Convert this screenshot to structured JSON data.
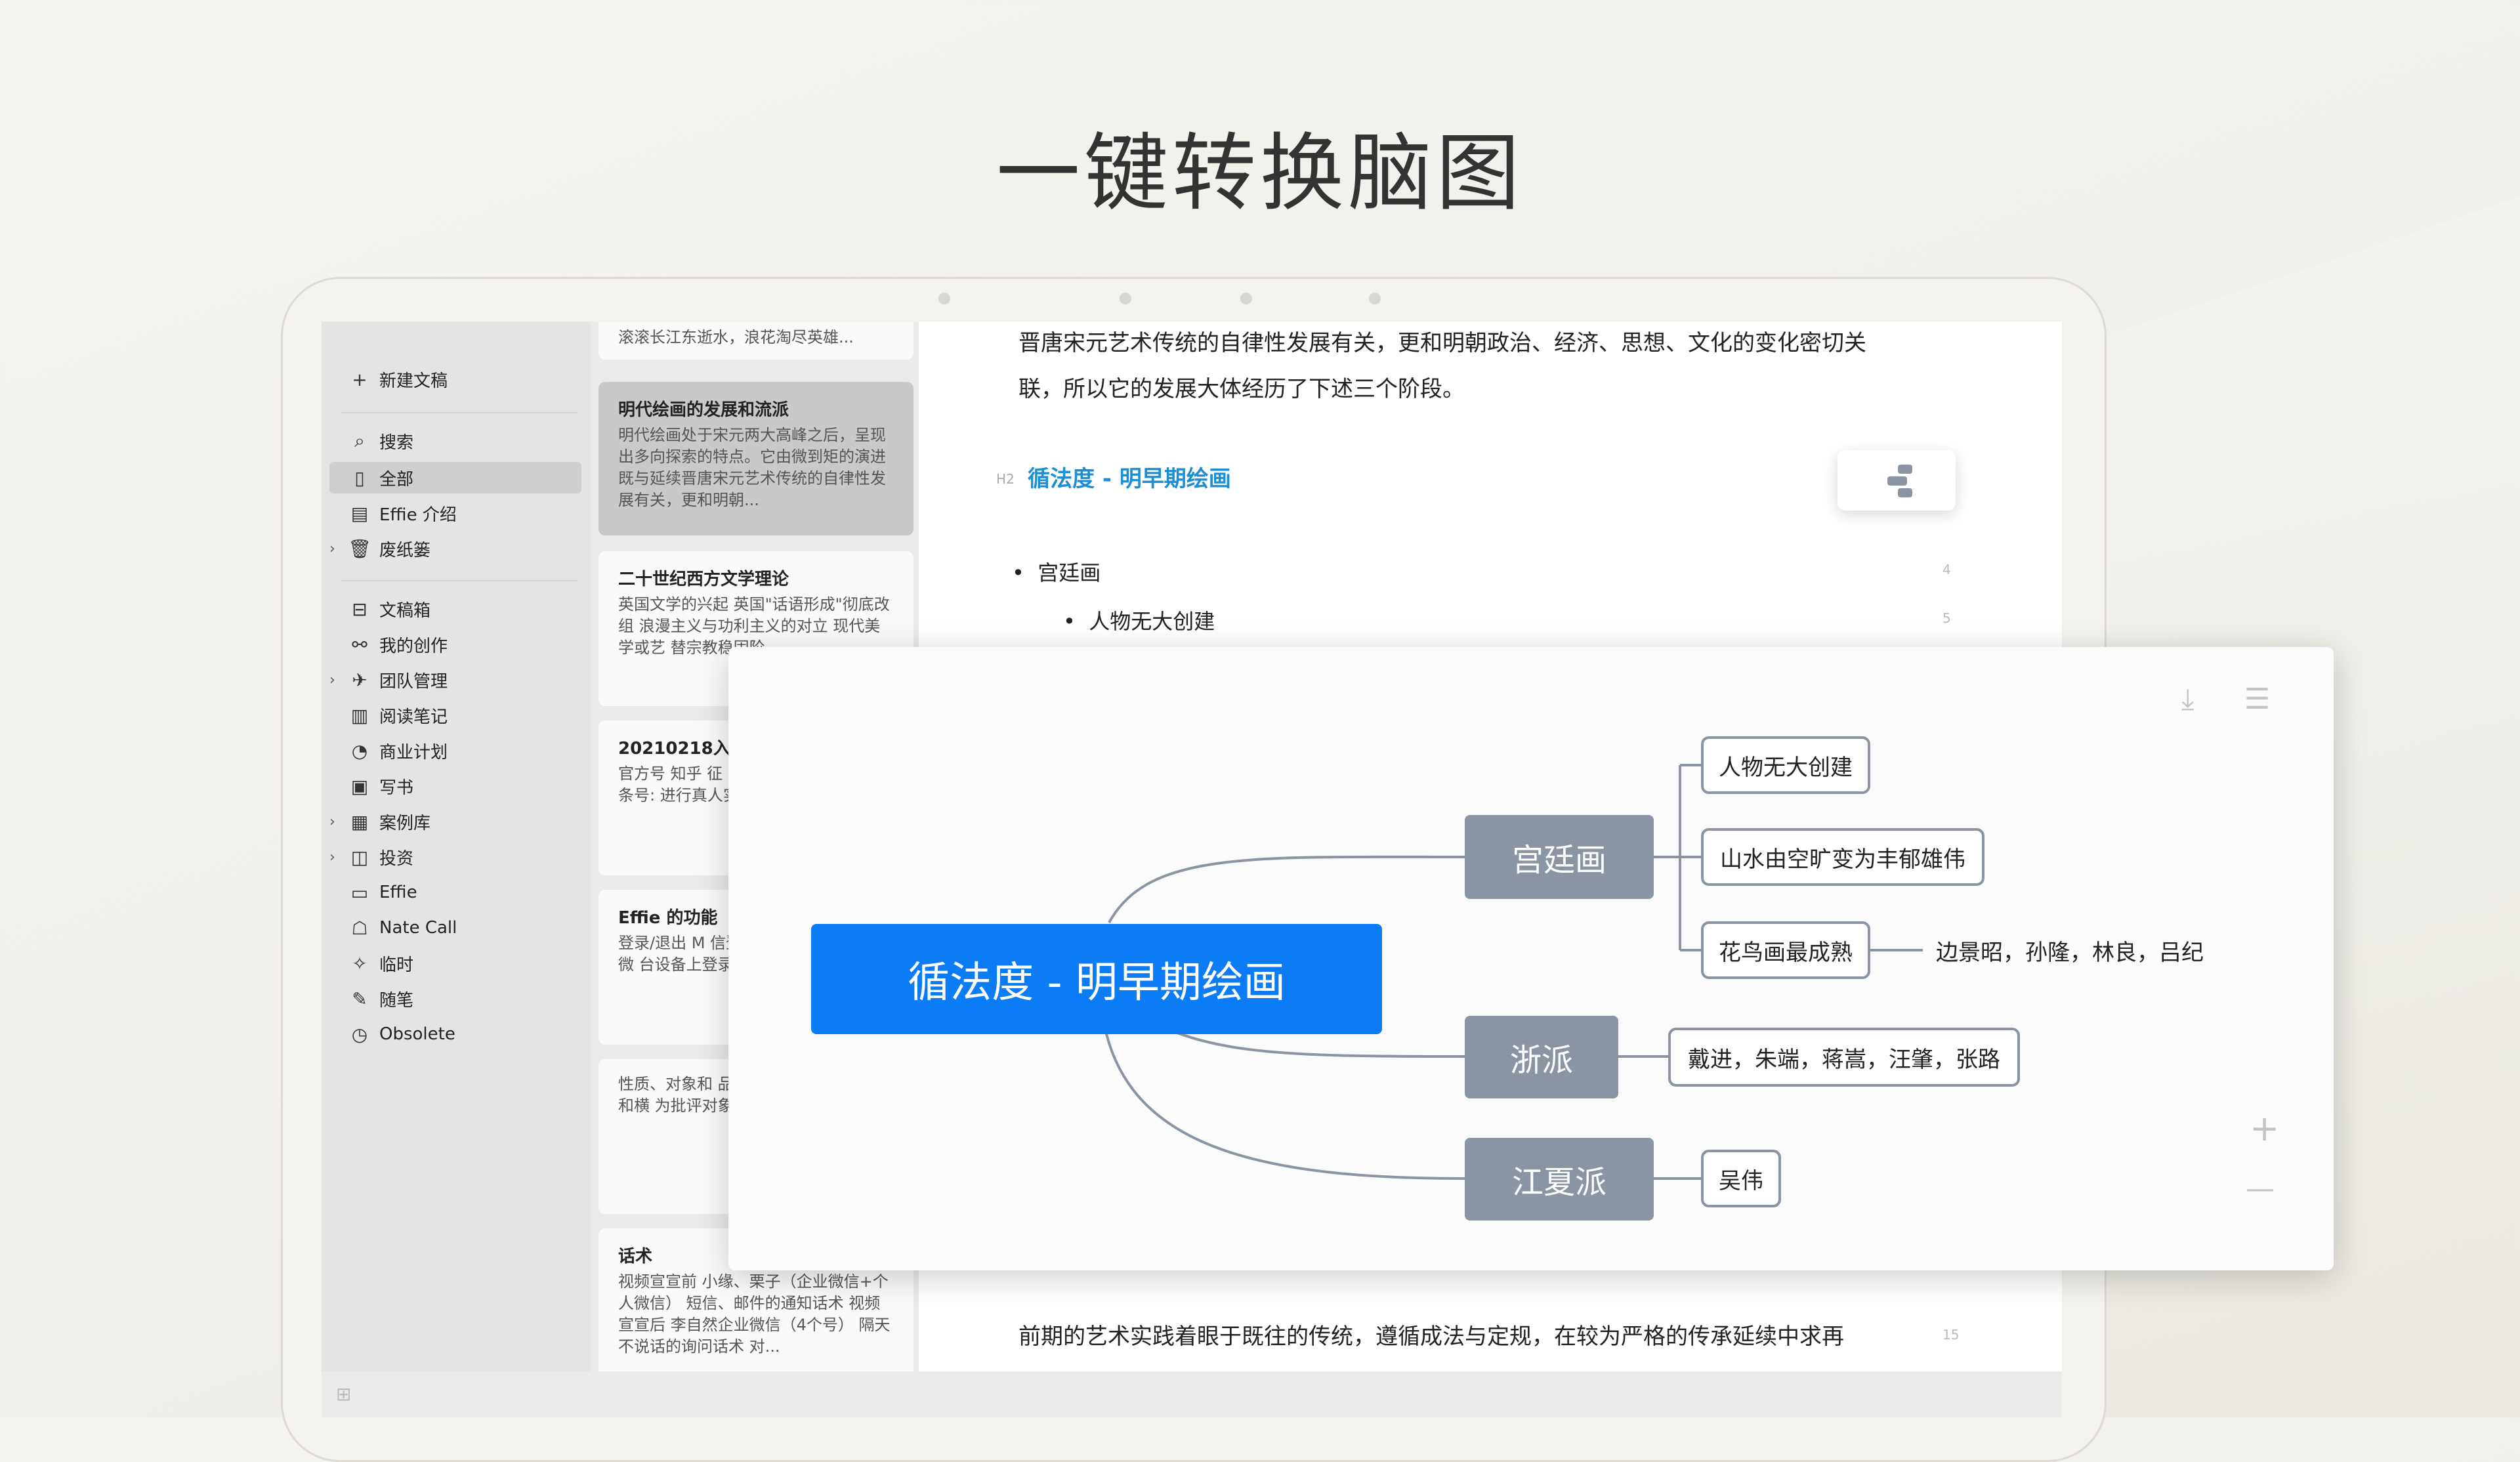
{
  "headline": "一键转换脑图",
  "sidebar": {
    "new_doc": "新建文稿",
    "items": [
      {
        "label": "搜索",
        "icon": "⌕"
      },
      {
        "label": "全部",
        "icon": "▯"
      },
      {
        "label": "Effie 介绍",
        "icon": "▤"
      },
      {
        "label": "废纸篓",
        "icon": "🗑"
      },
      {
        "label": "文稿箱",
        "icon": "⊟"
      },
      {
        "label": "我的创作",
        "icon": "⚯"
      },
      {
        "label": "团队管理",
        "icon": "✈"
      },
      {
        "label": "阅读笔记",
        "icon": "▥"
      },
      {
        "label": "商业计划",
        "icon": "◔"
      },
      {
        "label": "写书",
        "icon": "▣"
      },
      {
        "label": "案例库",
        "icon": "▦"
      },
      {
        "label": "投资",
        "icon": "◫"
      },
      {
        "label": "Effie",
        "icon": "▭"
      },
      {
        "label": "Nate Call",
        "icon": "☖"
      },
      {
        "label": "临时",
        "icon": "✧"
      },
      {
        "label": "随笔",
        "icon": "✎"
      },
      {
        "label": "Obsolete",
        "icon": "◷"
      }
    ]
  },
  "doclist": {
    "cards": [
      {
        "title": "",
        "body": "滚滚长江东逝水，浪花淘尽英雄..."
      },
      {
        "title": "明代绘画的发展和流派",
        "body": "明代绘画处于宋元两大高峰之后，呈现出多向探索的特点。它由微到矩的演进既与延续晋唐宋元艺术传统的自律性发展有关，更和明朝..."
      },
      {
        "title": "二十世纪西方文学理论",
        "body": "英国文学的兴起 英国\"话语形成\"彻底改组 浪漫主义与功利主义的对立 现代美学或艺 替宗教稳固阶"
      },
      {
        "title": "20210218入",
        "body": "官方号 知乎 征 百度 界面 一人 鹏号 头条号: 进行真人实名"
      },
      {
        "title": "Effie 的功能",
        "body": "登录/退出 M 信登录 | App 目前只支持微 台设备上登录"
      },
      {
        "title": "",
        "body": "性质、对象和 品格的确立人 能、理论和横 为批评对象 科 发展过程 预测"
      },
      {
        "title": "话术",
        "body": "视频宣宣前 小缘、栗子（企业微信+个人微信） 短信、邮件的通知话术 视频宣宣后 李自然企业微信（4个号） 隔天不说话的询问话术 对..."
      }
    ]
  },
  "editor": {
    "para_top": [
      "晋唐宋元艺术传统的自律性发展有关，更和明朝政治、经济、思想、文化的变化密切关",
      "联，所以它的发展大体经历了下述三个阶段。"
    ],
    "h2_tag": "H2",
    "h2_title": "循法度 - 明早期绘画",
    "bullet1": "宫廷画",
    "bullet1_num": "4",
    "bullet2": "人物无大创建",
    "bullet2_num": "5",
    "para_bottom": "前期的艺术实践着眼于既往的传统，遵循成法与定规，在较为严格的传承延续中求再",
    "para_bottom_num": "15"
  },
  "mindmap": {
    "root": "循法度 - 明早期绘画",
    "branches": [
      {
        "label": "宫廷画",
        "children": [
          "人物无大创建",
          "山水由空旷变为丰郁雄伟",
          "花鸟画最成熟"
        ],
        "extra": "边景昭，孙隆，林良，吕纪"
      },
      {
        "label": "浙派",
        "children": [
          "戴进，朱端，蒋嵩，汪肇，张路"
        ]
      },
      {
        "label": "江夏派",
        "children": [
          "吴伟"
        ]
      }
    ],
    "tools": {
      "download": "⤓",
      "menu": "☰",
      "zoom_in": "+",
      "zoom_out": "—"
    }
  }
}
